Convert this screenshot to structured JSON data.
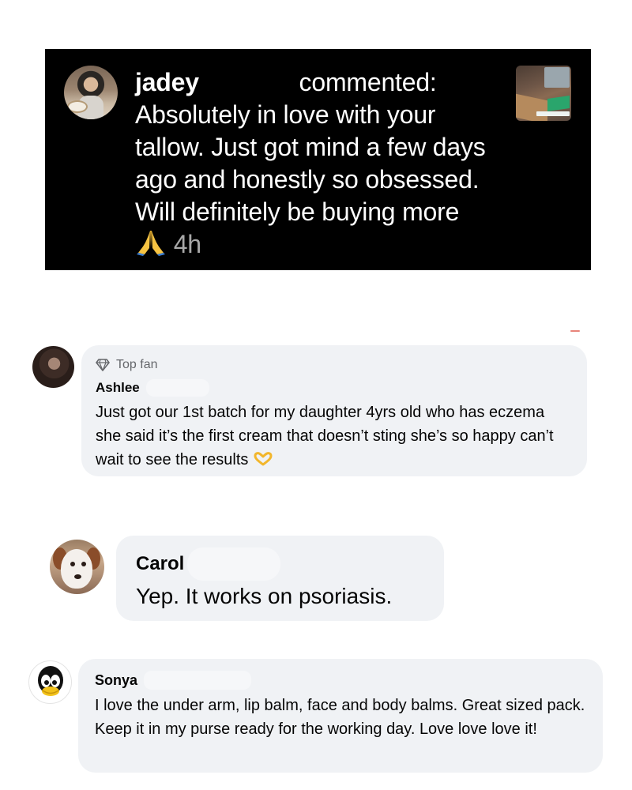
{
  "instagram_comment": {
    "username": "jadey",
    "action": "commented:",
    "text": "Absolutely in love with your tallow. Just got mind a few days ago and honestly so obsessed. Will definitely be buying more",
    "emoji_icon": "folded-hands-icon",
    "time": "4h"
  },
  "comments": [
    {
      "badge_label": "Top fan",
      "badge_icon": "diamond-icon",
      "name": "Ashlee",
      "text": "Just got our 1st batch for my daughter 4yrs old who has eczema she said it’s the first cream that doesn’t sting she’s so happy can’t wait to see the results",
      "emoji_icon": "heart-hands-icon"
    },
    {
      "name": "Carol",
      "text": "Yep. It works on psoriasis."
    },
    {
      "name": "Sonya",
      "text": "I love the under arm, lip balm, face and body balms. Great sized pack. Keep it in my purse ready for the working day. Love love love it!"
    }
  ],
  "colors": {
    "dark_card_bg": "#000000",
    "bubble_bg": "#f0f2f5",
    "muted_text": "#65676b",
    "time_text": "#a8a8a8"
  }
}
